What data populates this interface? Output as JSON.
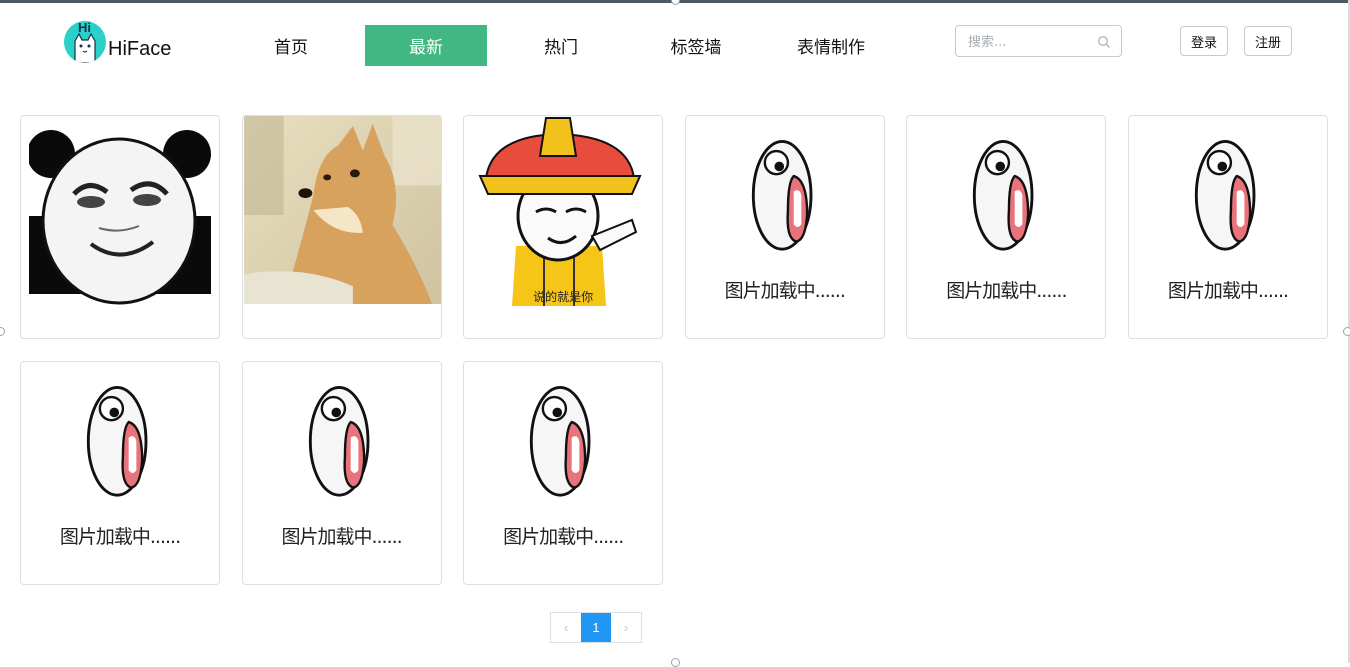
{
  "brand": {
    "name": "HiFace",
    "badge": "Hi",
    "color": "#2bd1c9"
  },
  "nav": [
    {
      "label": "首页",
      "active": false
    },
    {
      "label": "最新",
      "active": true
    },
    {
      "label": "热门",
      "active": false
    },
    {
      "label": "标签墙",
      "active": false
    },
    {
      "label": "表情制作",
      "active": false
    }
  ],
  "accent": "#41b883",
  "search": {
    "placeholder": "搜索...",
    "value": "",
    "icon": "search-icon"
  },
  "auth": {
    "login": "登录",
    "register": "注册"
  },
  "cards": [
    {
      "kind": "panda-meme",
      "caption": ""
    },
    {
      "kind": "doge-photo",
      "caption": ""
    },
    {
      "kind": "emperor-meme",
      "caption": "说的就是你"
    },
    {
      "kind": "loading",
      "caption": "图片加载中......"
    },
    {
      "kind": "loading",
      "caption": "图片加载中......"
    },
    {
      "kind": "loading",
      "caption": "图片加载中......"
    },
    {
      "kind": "loading",
      "caption": "图片加载中......"
    },
    {
      "kind": "loading",
      "caption": "图片加载中......"
    },
    {
      "kind": "loading",
      "caption": "图片加载中......"
    }
  ],
  "pagination": {
    "current": "1",
    "prev": "‹",
    "next": "›",
    "current_color": "#2196f3"
  }
}
